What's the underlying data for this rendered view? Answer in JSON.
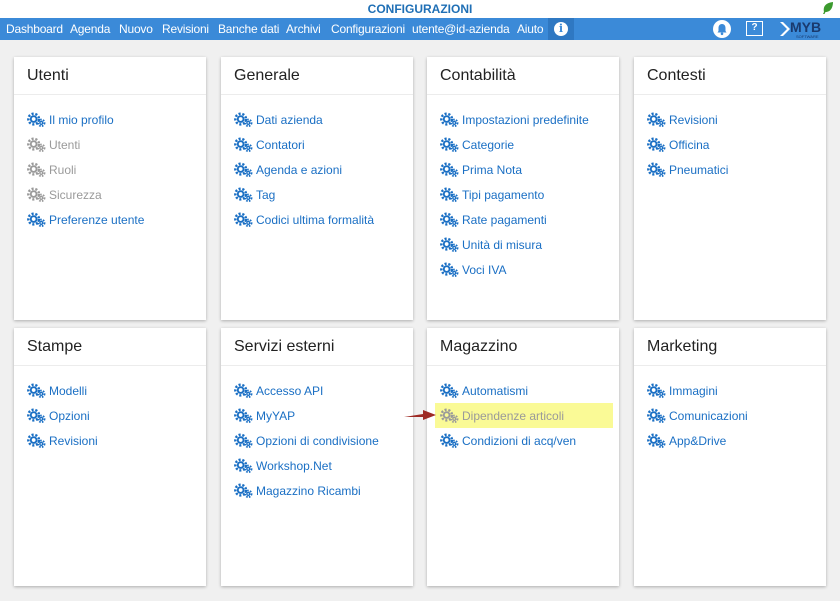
{
  "title": "CONFIGURAZIONI",
  "nav": {
    "items": [
      "Dashboard",
      "Agenda",
      "Nuovo",
      "Revisioni",
      "Banche dati",
      "Archivi",
      "Configurazioni",
      "utente@id-azienda",
      "Aiuto"
    ],
    "info_label": "i",
    "help_label": "?"
  },
  "logo": {
    "text": "MYB",
    "sub": "SOFTWARE"
  },
  "colors": {
    "nav": "#3b8ad8",
    "link": "#1a6fc4",
    "disabled": "#9a9a9a",
    "highlight": "#fafa96",
    "arrow": "#9e2b25"
  },
  "cards": [
    {
      "title": "Utenti",
      "items": [
        {
          "label": "Il mio profilo",
          "enabled": true
        },
        {
          "label": "Utenti",
          "enabled": false
        },
        {
          "label": "Ruoli",
          "enabled": false
        },
        {
          "label": "Sicurezza",
          "enabled": false
        },
        {
          "label": "Preferenze utente",
          "enabled": true
        }
      ]
    },
    {
      "title": "Generale",
      "items": [
        {
          "label": "Dati azienda",
          "enabled": true
        },
        {
          "label": "Contatori",
          "enabled": true
        },
        {
          "label": "Agenda e azioni",
          "enabled": true
        },
        {
          "label": "Tag",
          "enabled": true
        },
        {
          "label": "Codici ultima formalità",
          "enabled": true
        }
      ]
    },
    {
      "title": "Contabilità",
      "items": [
        {
          "label": "Impostazioni predefinite",
          "enabled": true
        },
        {
          "label": "Categorie",
          "enabled": true
        },
        {
          "label": "Prima Nota",
          "enabled": true
        },
        {
          "label": "Tipi pagamento",
          "enabled": true
        },
        {
          "label": "Rate pagamenti",
          "enabled": true
        },
        {
          "label": "Unità di misura",
          "enabled": true
        },
        {
          "label": "Voci IVA",
          "enabled": true
        }
      ]
    },
    {
      "title": "Contesti",
      "items": [
        {
          "label": "Revisioni",
          "enabled": true
        },
        {
          "label": "Officina",
          "enabled": true
        },
        {
          "label": "Pneumatici",
          "enabled": true
        }
      ]
    },
    {
      "title": "Stampe",
      "items": [
        {
          "label": "Modelli",
          "enabled": true
        },
        {
          "label": "Opzioni",
          "enabled": true
        },
        {
          "label": "Revisioni",
          "enabled": true
        }
      ]
    },
    {
      "title": "Servizi esterni",
      "items": [
        {
          "label": "Accesso API",
          "enabled": true
        },
        {
          "label": "MyYAP",
          "enabled": true
        },
        {
          "label": "Opzioni di condivisione",
          "enabled": true
        },
        {
          "label": "Workshop.Net",
          "enabled": true
        },
        {
          "label": "Magazzino Ricambi",
          "enabled": true
        }
      ]
    },
    {
      "title": "Magazzino",
      "items": [
        {
          "label": "Automatismi",
          "enabled": true
        },
        {
          "label": "Dipendenze articoli",
          "enabled": false,
          "highlighted": true
        },
        {
          "label": "Condizioni di acq/ven",
          "enabled": true
        }
      ]
    },
    {
      "title": "Marketing",
      "items": [
        {
          "label": "Immagini",
          "enabled": true
        },
        {
          "label": "Comunicazioni",
          "enabled": true
        },
        {
          "label": "App&Drive",
          "enabled": true
        }
      ]
    }
  ]
}
